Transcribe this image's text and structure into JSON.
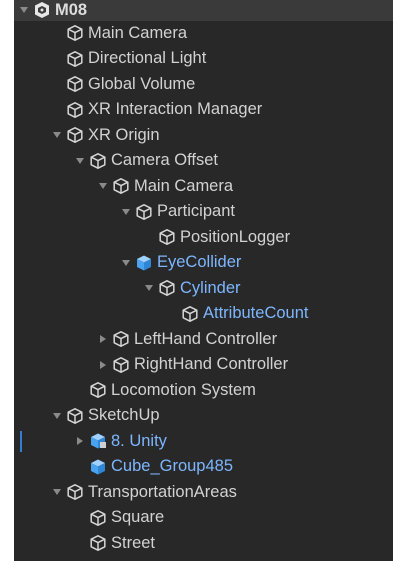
{
  "hierarchy": {
    "items": [
      {
        "label": "M08",
        "depth": 0,
        "arrow": "expanded",
        "icon": "scene-icon",
        "style": "header"
      },
      {
        "label": "Main Camera",
        "depth": 1,
        "arrow": "none",
        "icon": "gameobject-icon",
        "style": "normal"
      },
      {
        "label": "Directional Light",
        "depth": 1,
        "arrow": "none",
        "icon": "gameobject-icon",
        "style": "normal"
      },
      {
        "label": "Global Volume",
        "depth": 1,
        "arrow": "none",
        "icon": "gameobject-icon",
        "style": "normal"
      },
      {
        "label": "XR Interaction Manager",
        "depth": 1,
        "arrow": "none",
        "icon": "gameobject-icon",
        "style": "normal"
      },
      {
        "label": "XR Origin",
        "depth": 1,
        "arrow": "expanded",
        "icon": "gameobject-icon",
        "style": "normal"
      },
      {
        "label": "Camera Offset",
        "depth": 2,
        "arrow": "expanded",
        "icon": "gameobject-icon",
        "style": "normal"
      },
      {
        "label": "Main Camera",
        "depth": 3,
        "arrow": "expanded",
        "icon": "gameobject-icon",
        "style": "normal"
      },
      {
        "label": "Participant",
        "depth": 4,
        "arrow": "expanded",
        "icon": "gameobject-icon",
        "style": "normal"
      },
      {
        "label": "PositionLogger",
        "depth": 5,
        "arrow": "none",
        "icon": "gameobject-icon",
        "style": "normal"
      },
      {
        "label": "EyeCollider",
        "depth": 4,
        "arrow": "expanded",
        "icon": "prefab-icon",
        "style": "prefab"
      },
      {
        "label": "Cylinder",
        "depth": 5,
        "arrow": "expanded",
        "icon": "gameobject-icon",
        "style": "prefab"
      },
      {
        "label": "AttributeCount",
        "depth": 6,
        "arrow": "none",
        "icon": "gameobject-icon",
        "style": "prefab"
      },
      {
        "label": "LeftHand Controller",
        "depth": 3,
        "arrow": "collapsed",
        "icon": "gameobject-icon",
        "style": "normal"
      },
      {
        "label": "RightHand Controller",
        "depth": 3,
        "arrow": "collapsed",
        "icon": "gameobject-icon",
        "style": "normal"
      },
      {
        "label": "Locomotion System",
        "depth": 2,
        "arrow": "none",
        "icon": "gameobject-icon",
        "style": "normal"
      },
      {
        "label": "SketchUp",
        "depth": 1,
        "arrow": "expanded",
        "icon": "gameobject-icon",
        "style": "normal"
      },
      {
        "label": "8. Unity",
        "depth": 2,
        "arrow": "collapsed",
        "icon": "prefab-model-icon",
        "style": "prefab",
        "strip": true
      },
      {
        "label": "Cube_Group485",
        "depth": 2,
        "arrow": "none",
        "icon": "prefab-icon",
        "style": "prefab"
      },
      {
        "label": "TransportationAreas",
        "depth": 1,
        "arrow": "expanded",
        "icon": "gameobject-icon",
        "style": "normal"
      },
      {
        "label": "Square",
        "depth": 2,
        "arrow": "none",
        "icon": "gameobject-icon",
        "style": "normal"
      },
      {
        "label": "Street",
        "depth": 2,
        "arrow": "none",
        "icon": "gameobject-icon",
        "style": "normal"
      }
    ]
  },
  "colors": {
    "background": "#282828",
    "text": "#d2d2d2",
    "prefab_text": "#7db6ff",
    "header_bg": "#3a3a3a",
    "selection_strip": "#2f7fd7"
  }
}
